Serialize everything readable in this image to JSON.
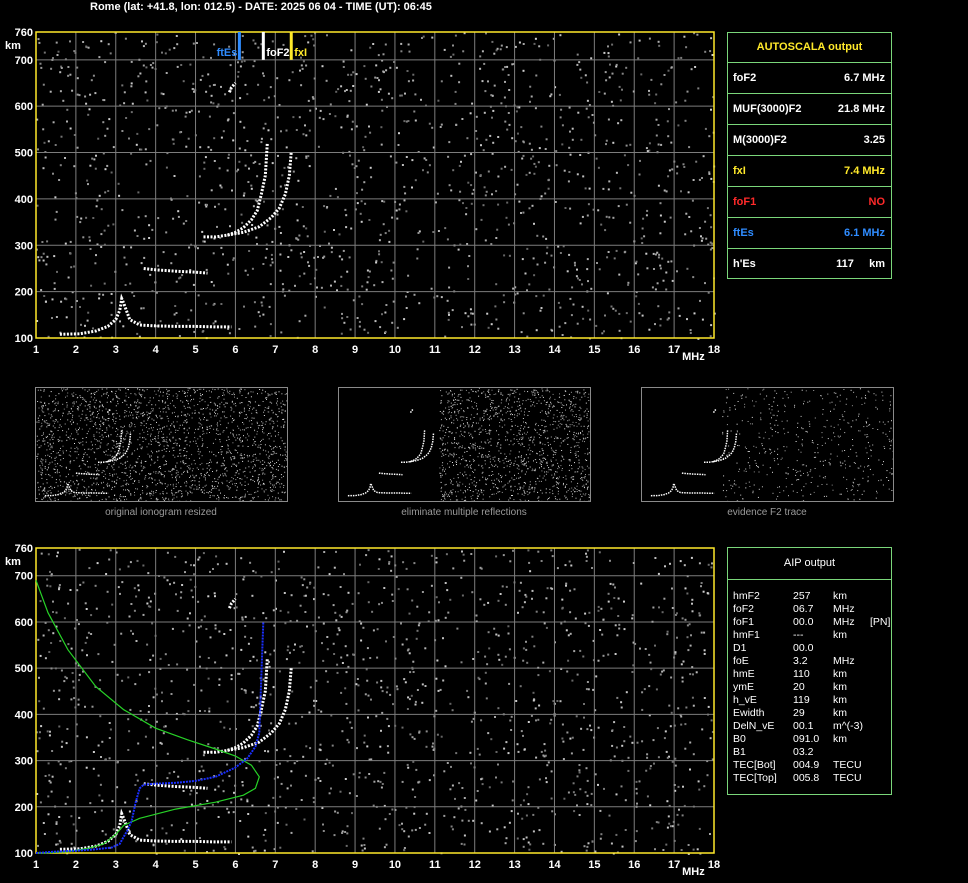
{
  "header": {
    "title": "Rome (lat: +41.8, lon: 012.5) - DATE: 2025 06 04 - TIME (UT): 06:45"
  },
  "colors": {
    "axes": "#ffe92a",
    "grid": "#7d7d7d",
    "trace": "#ffffff",
    "fo_f2": "#ffffff",
    "ft_es": "#2f8cff",
    "fx_i": "#ffe92a",
    "fo_f1": "#ff2a2a",
    "panel_border": "#7ad67a",
    "profile_green": "#27d227",
    "profile_blue": "#1a2fff"
  },
  "chart_data": [
    {
      "type": "scatter",
      "id": "top-ionogram",
      "xlabel": "MHz",
      "ylabel": "km",
      "xlim": [
        1,
        18
      ],
      "ylim": [
        100,
        760
      ],
      "xticks": [
        1,
        2,
        3,
        4,
        5,
        6,
        7,
        8,
        9,
        10,
        11,
        12,
        13,
        14,
        15,
        16,
        17,
        18
      ],
      "yticks": [
        100,
        200,
        300,
        400,
        500,
        600,
        700,
        760
      ],
      "grid": true,
      "markers": [
        {
          "label": "ftEs",
          "freq": 6.1,
          "color": "#2f8cff"
        },
        {
          "label": "foF2",
          "freq": 6.7,
          "color": "#ffffff"
        },
        {
          "label": "fxI",
          "freq": 7.4,
          "color": "#ffe92a"
        }
      ],
      "traces": {
        "es_trace": {
          "x": [
            1.6,
            2.1,
            2.5,
            2.8,
            3.0,
            3.1,
            3.15,
            3.2,
            3.35,
            3.6,
            4.0,
            4.5,
            5.0,
            5.5,
            5.9
          ],
          "y": [
            108,
            109,
            115,
            125,
            140,
            160,
            185,
            175,
            140,
            128,
            126,
            125,
            125,
            124,
            124
          ]
        },
        "es_second": {
          "x": [
            3.7,
            4.0,
            4.5,
            5.0,
            5.3
          ],
          "y": [
            250,
            247,
            244,
            242,
            240
          ]
        },
        "f2_o": {
          "x": [
            5.2,
            5.5,
            5.8,
            6.0,
            6.2,
            6.4,
            6.55,
            6.65,
            6.75,
            6.8
          ],
          "y": [
            318,
            318,
            322,
            328,
            338,
            355,
            375,
            410,
            450,
            520
          ]
        },
        "f2_x": {
          "x": [
            5.8,
            6.2,
            6.6,
            6.9,
            7.1,
            7.25,
            7.35,
            7.4
          ],
          "y": [
            322,
            328,
            340,
            360,
            380,
            410,
            450,
            500
          ]
        },
        "f2_spot": {
          "x": [
            5.85,
            5.9,
            6.0
          ],
          "y": [
            630,
            640,
            650
          ]
        }
      }
    },
    {
      "type": "scatter",
      "id": "bottom-ionogram",
      "xlabel": "MHz",
      "ylabel": "km",
      "xlim": [
        1,
        18
      ],
      "ylim": [
        100,
        760
      ],
      "xticks": [
        1,
        2,
        3,
        4,
        5,
        6,
        7,
        8,
        9,
        10,
        11,
        12,
        13,
        14,
        15,
        16,
        17,
        18
      ],
      "yticks": [
        100,
        200,
        300,
        400,
        500,
        600,
        700,
        760
      ],
      "grid": true,
      "traces": {
        "es_trace": {
          "x": [
            1.6,
            2.1,
            2.5,
            2.8,
            3.0,
            3.1,
            3.15,
            3.2,
            3.35,
            3.6,
            4.0,
            4.5,
            5.0,
            5.5,
            5.9
          ],
          "y": [
            108,
            109,
            115,
            125,
            140,
            160,
            185,
            175,
            140,
            128,
            126,
            125,
            125,
            124,
            124
          ]
        },
        "es_second": {
          "x": [
            3.7,
            4.0,
            4.5,
            5.0,
            5.3
          ],
          "y": [
            250,
            247,
            244,
            242,
            240
          ]
        },
        "f2_o": {
          "x": [
            5.2,
            5.5,
            5.8,
            6.0,
            6.2,
            6.4,
            6.55,
            6.65,
            6.75,
            6.8
          ],
          "y": [
            318,
            318,
            322,
            328,
            338,
            355,
            375,
            410,
            450,
            520
          ]
        },
        "f2_x": {
          "x": [
            5.8,
            6.2,
            6.6,
            6.9,
            7.1,
            7.25,
            7.35,
            7.4
          ],
          "y": [
            322,
            328,
            340,
            360,
            380,
            410,
            450,
            500
          ]
        },
        "f2_spot": {
          "x": [
            5.85,
            5.9,
            6.0
          ],
          "y": [
            630,
            640,
            650
          ]
        },
        "profile_green": {
          "x": [
            1.0,
            1.3,
            1.8,
            2.5,
            3.2,
            4.0,
            4.8,
            5.5,
            6.0,
            6.4,
            6.6,
            6.5,
            6.2,
            5.5,
            4.5,
            3.6,
            3.2,
            3.0,
            2.7,
            2.3,
            1.8,
            1.2,
            1.0
          ],
          "y": [
            690,
            620,
            540,
            460,
            410,
            370,
            345,
            325,
            310,
            290,
            265,
            240,
            225,
            210,
            195,
            175,
            160,
            140,
            120,
            110,
            103,
            100,
            100
          ]
        },
        "profile_blue": {
          "x": [
            1.0,
            1.5,
            2.0,
            2.5,
            2.9,
            3.1,
            3.2,
            3.3,
            3.4,
            3.5,
            3.6,
            3.7,
            4.0,
            4.5,
            5.0,
            5.5,
            6.0,
            6.3,
            6.5,
            6.6,
            6.7
          ],
          "y": [
            100,
            103,
            105,
            108,
            112,
            120,
            135,
            150,
            170,
            210,
            240,
            248,
            250,
            252,
            256,
            265,
            285,
            305,
            330,
            360,
            600
          ]
        }
      }
    }
  ],
  "thumbnails": [
    {
      "caption": "original ionogram resized"
    },
    {
      "caption": "eliminate multiple reflections"
    },
    {
      "caption": "evidence F2 trace"
    }
  ],
  "autoscala": {
    "title": "AUTOSCALA output",
    "rows": [
      {
        "label": "foF2",
        "value": "6.7 MHz",
        "color": "#ffffff"
      },
      {
        "label": "MUF(3000)F2",
        "value": "21.8 MHz",
        "color": "#ffffff"
      },
      {
        "label": "M(3000)F2",
        "value": "3.25",
        "color": "#ffffff"
      },
      {
        "label": "fxI",
        "value": "7.4 MHz",
        "color": "#ffe92a"
      },
      {
        "label": "foF1",
        "value": "NO",
        "color": "#ff2a2a"
      },
      {
        "label": "ftEs",
        "value": "6.1 MHz",
        "color": "#2f8cff"
      },
      {
        "label": "h'Es",
        "value": "117     km",
        "color": "#ffffff"
      }
    ]
  },
  "aip": {
    "title": "AIP output",
    "rows": [
      {
        "param": "hmF2",
        "value": "257",
        "unit": "km",
        "note": ""
      },
      {
        "param": "foF2",
        "value": "06.7",
        "unit": "MHz",
        "note": ""
      },
      {
        "param": "foF1",
        "value": "00.0",
        "unit": "MHz",
        "note": "[PN]"
      },
      {
        "param": "hmF1",
        "value": "---",
        "unit": "km",
        "note": ""
      },
      {
        "param": "D1",
        "value": "00.0",
        "unit": "",
        "note": ""
      },
      {
        "param": "foE",
        "value": "3.2",
        "unit": "MHz",
        "note": ""
      },
      {
        "param": "hmE",
        "value": "110",
        "unit": "km",
        "note": ""
      },
      {
        "param": "ymE",
        "value": "20",
        "unit": "km",
        "note": ""
      },
      {
        "param": "h_vE",
        "value": "119",
        "unit": "km",
        "note": ""
      },
      {
        "param": "Ewidth",
        "value": "29",
        "unit": "km",
        "note": ""
      },
      {
        "param": "DelN_vE",
        "value": "00.1",
        "unit": "m^(-3)",
        "note": ""
      },
      {
        "param": "B0",
        "value": "091.0",
        "unit": "km",
        "note": ""
      },
      {
        "param": "B1",
        "value": "03.2",
        "unit": "",
        "note": ""
      },
      {
        "param": "TEC[Bot]",
        "value": "004.9",
        "unit": "TECU",
        "note": ""
      },
      {
        "param": "TEC[Top]",
        "value": "005.8",
        "unit": "TECU",
        "note": ""
      }
    ]
  }
}
